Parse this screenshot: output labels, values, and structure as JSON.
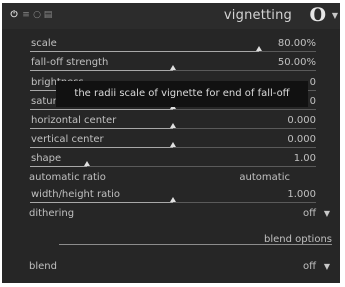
{
  "header": {
    "title": "vignetting",
    "module_icon": "O",
    "power_icon": "⏻",
    "menu_icon": "≡",
    "reset_icon": "○",
    "presets_icon": "▤",
    "collapse_icon": "▼"
  },
  "params": [
    {
      "label": "scale",
      "value": "80.00%",
      "level": 0.8
    },
    {
      "label": "fall-off strength",
      "value": "50.00%",
      "level": 0.5
    },
    {
      "label": "brightness",
      "value": "0",
      "level": 0.5
    },
    {
      "label": "saturation",
      "value": "0",
      "level": 0.5
    },
    {
      "label": "horizontal center",
      "value": "0.000",
      "level": 0.5
    },
    {
      "label": "vertical center",
      "value": "0.000",
      "level": 0.5
    },
    {
      "label": "shape",
      "value": "1.00",
      "level": 0.2
    },
    {
      "label": "automatic ratio",
      "value": "automatic"
    },
    {
      "label": "width/height ratio",
      "value": "1.000",
      "level": 0.5
    },
    {
      "label": "dithering",
      "value": "off"
    }
  ],
  "blend_section": "blend options",
  "blend": {
    "label": "blend",
    "value": "off"
  },
  "dropdown_icon": "▼",
  "tooltip": "the radii scale of vignette for end of fall-off",
  "colors": {
    "panel": "#262626",
    "header": "#2c2c2c",
    "text": "#c0c0c0",
    "tooltip_bg": "#111111"
  }
}
